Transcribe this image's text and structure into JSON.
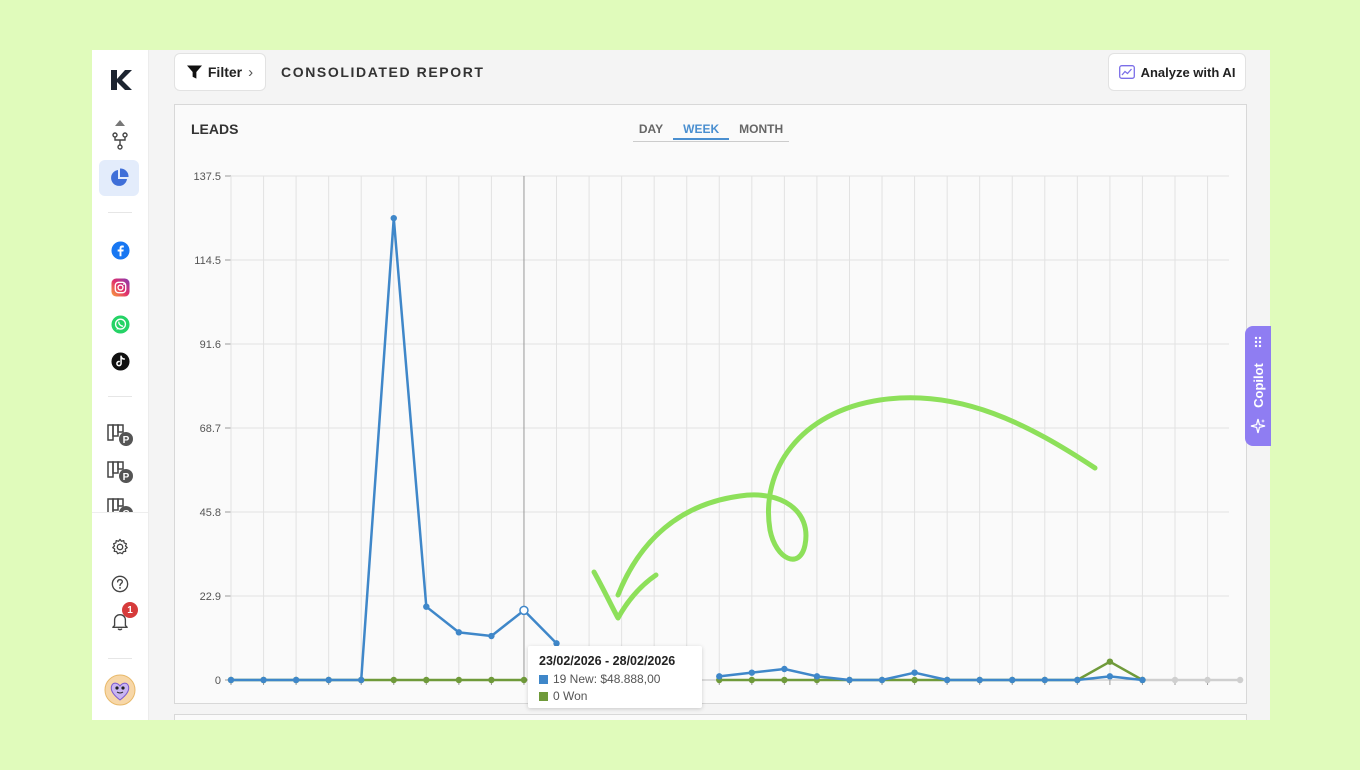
{
  "topbar": {
    "filter_label": "Filter",
    "filter_chevron": "›",
    "page_title": "CONSOLIDATED REPORT",
    "analyze_label": "Analyze with AI"
  },
  "sidebar": {
    "logo": "K",
    "items": [
      {
        "icon": "flow-icon"
      },
      {
        "icon": "pie-chart-icon",
        "active": true
      },
      {
        "icon": "facebook-icon"
      },
      {
        "icon": "instagram-icon"
      },
      {
        "icon": "whatsapp-icon"
      },
      {
        "icon": "tiktok-icon"
      },
      {
        "icon": "pipeline-icon",
        "badge": "P"
      },
      {
        "icon": "pipeline-icon",
        "badge": "P"
      },
      {
        "icon": "pipeline-icon",
        "badge": "C"
      },
      {
        "icon": "gear-icon"
      },
      {
        "icon": "help-icon"
      },
      {
        "icon": "bell-icon",
        "count": "1"
      },
      {
        "icon": "avatar"
      }
    ]
  },
  "card": {
    "title": "LEADS",
    "tabs": [
      {
        "label": "DAY",
        "active": false
      },
      {
        "label": "WEEK",
        "active": true
      },
      {
        "label": "MONTH",
        "active": false
      }
    ]
  },
  "tooltip": {
    "title": "23/02/2026 - 28/02/2026",
    "rows": [
      {
        "color": "#3f87c9",
        "text": "19 New: $48.888,00"
      },
      {
        "color": "#6f9a3a",
        "text": "0 Won"
      }
    ]
  },
  "copilot": {
    "label": "Copilot"
  },
  "colors": {
    "new_series": "#3f87c9",
    "won_series": "#6f9a3a",
    "annotation_arrow": "#8de05a",
    "accent": "#4a8fd0",
    "copilot": "#8f7df2"
  },
  "chart_data": {
    "type": "line",
    "title": "LEADS",
    "ylim": [
      0,
      137.5
    ],
    "yticks": [
      "0",
      "22.9",
      "45.8",
      "68.7",
      "91.6",
      "114.5",
      "137.5"
    ],
    "grid": true,
    "x_count": 32,
    "highlight_index": 9,
    "series": [
      {
        "name": "New",
        "color": "#3f87c9",
        "values": [
          0,
          0,
          0,
          0,
          0,
          126,
          20,
          13,
          12,
          19,
          10,
          null,
          null,
          null,
          null,
          1,
          2,
          3,
          1,
          0,
          0,
          2,
          0,
          0,
          0,
          0,
          0,
          1,
          0,
          null,
          null,
          null
        ]
      },
      {
        "name": "Won",
        "color": "#6f9a3a",
        "values": [
          0,
          0,
          0,
          0,
          0,
          0,
          0,
          0,
          0,
          0,
          null,
          null,
          null,
          null,
          null,
          0,
          0,
          0,
          0,
          0,
          0,
          0,
          0,
          0,
          0,
          0,
          0,
          5,
          0,
          null,
          null,
          null
        ]
      },
      {
        "color": "#cfcfcf",
        "values": [
          null,
          null,
          null,
          null,
          null,
          null,
          null,
          null,
          null,
          null,
          null,
          null,
          null,
          null,
          null,
          null,
          null,
          null,
          null,
          null,
          null,
          null,
          null,
          null,
          null,
          null,
          null,
          null,
          0,
          0,
          0,
          0
        ]
      }
    ]
  }
}
